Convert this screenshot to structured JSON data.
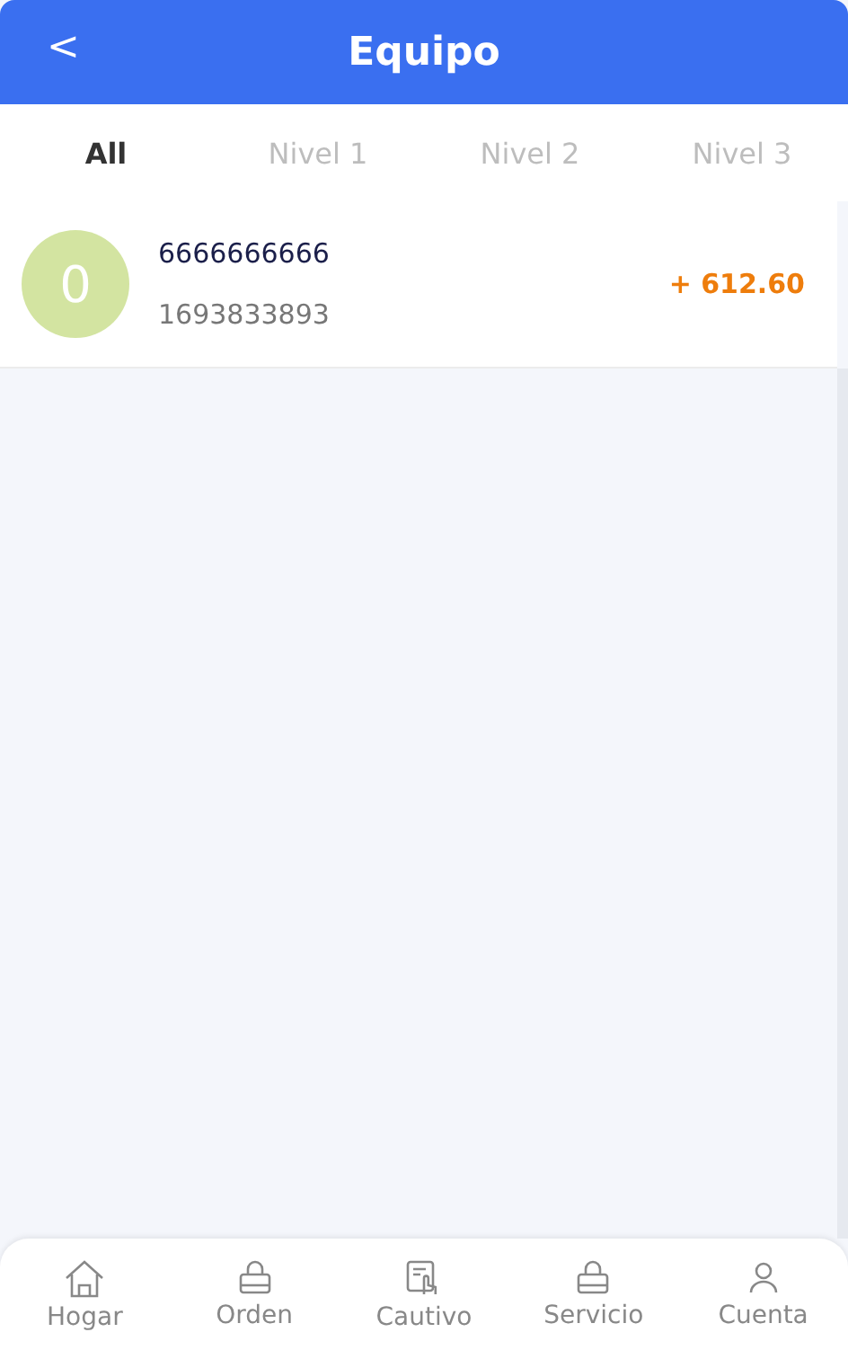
{
  "header": {
    "back": "<",
    "title": "Equipo"
  },
  "tabs": [
    {
      "label": "All",
      "selected": true
    },
    {
      "label": "Nivel 1",
      "selected": false
    },
    {
      "label": "Nivel 2",
      "selected": false
    },
    {
      "label": "Nivel 3",
      "selected": false
    }
  ],
  "members": [
    {
      "avatar": "0",
      "name": "6666666666",
      "id": "1693833893",
      "amount": "+ 612.60"
    }
  ],
  "nav": [
    {
      "kind": "home",
      "label": "Hogar"
    },
    {
      "kind": "bag",
      "label": "Orden"
    },
    {
      "kind": "touch",
      "label": "Cautivo"
    },
    {
      "kind": "bag",
      "label": "Servicio"
    },
    {
      "kind": "user",
      "label": "Cuenta"
    }
  ]
}
